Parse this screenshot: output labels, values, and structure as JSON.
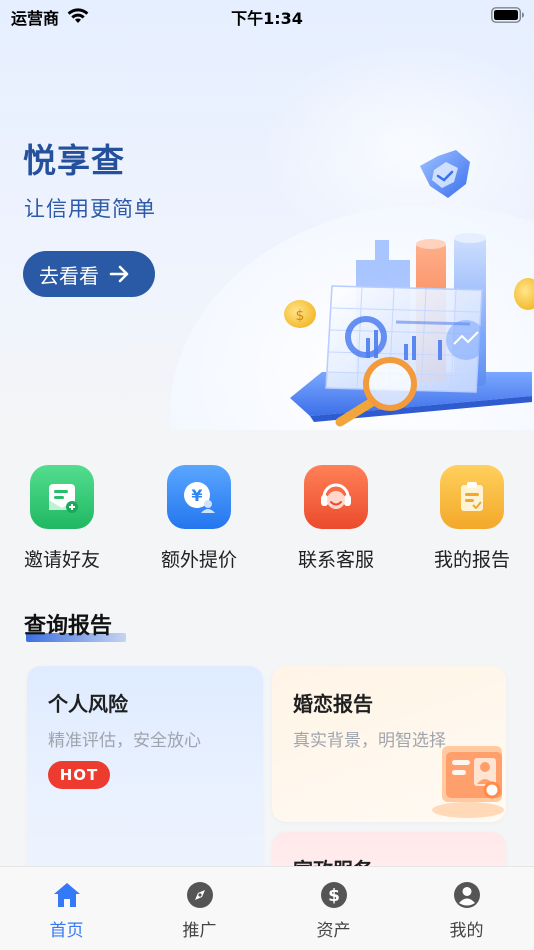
{
  "status_bar": {
    "carrier": "运营商",
    "time": "下午1:34"
  },
  "hero": {
    "title": "悦享查",
    "slogan": "让信用更简单",
    "button_label": "去看看"
  },
  "quick_actions": [
    {
      "label": "邀请好友",
      "icon": "invite-friend-icon",
      "color": "#2fc46f"
    },
    {
      "label": "额外提价",
      "icon": "extra-price-icon",
      "color": "#2f86f2"
    },
    {
      "label": "联系客服",
      "icon": "customer-service-icon",
      "color": "#f25a3c"
    },
    {
      "label": "我的报告",
      "icon": "my-report-icon",
      "color": "#f7b73a"
    }
  ],
  "report_section": {
    "title": "查询报告",
    "cards": [
      {
        "title": "个人风险",
        "subtitle": "精准评估，安全放心",
        "badge": "HOT"
      },
      {
        "title": "婚恋报告",
        "subtitle": "真实背景，明智选择"
      },
      {
        "title": "家政服务"
      }
    ]
  },
  "tab_bar": {
    "tabs": [
      {
        "label": "首页",
        "icon": "home-icon",
        "active": true
      },
      {
        "label": "推广",
        "icon": "compass-icon",
        "active": false
      },
      {
        "label": "资产",
        "icon": "dollar-icon",
        "active": false
      },
      {
        "label": "我的",
        "icon": "user-icon",
        "active": false
      }
    ]
  },
  "colors": {
    "primary": "#2a5aa5",
    "tab_active": "#3479f6",
    "hot": "#ee3b30"
  }
}
